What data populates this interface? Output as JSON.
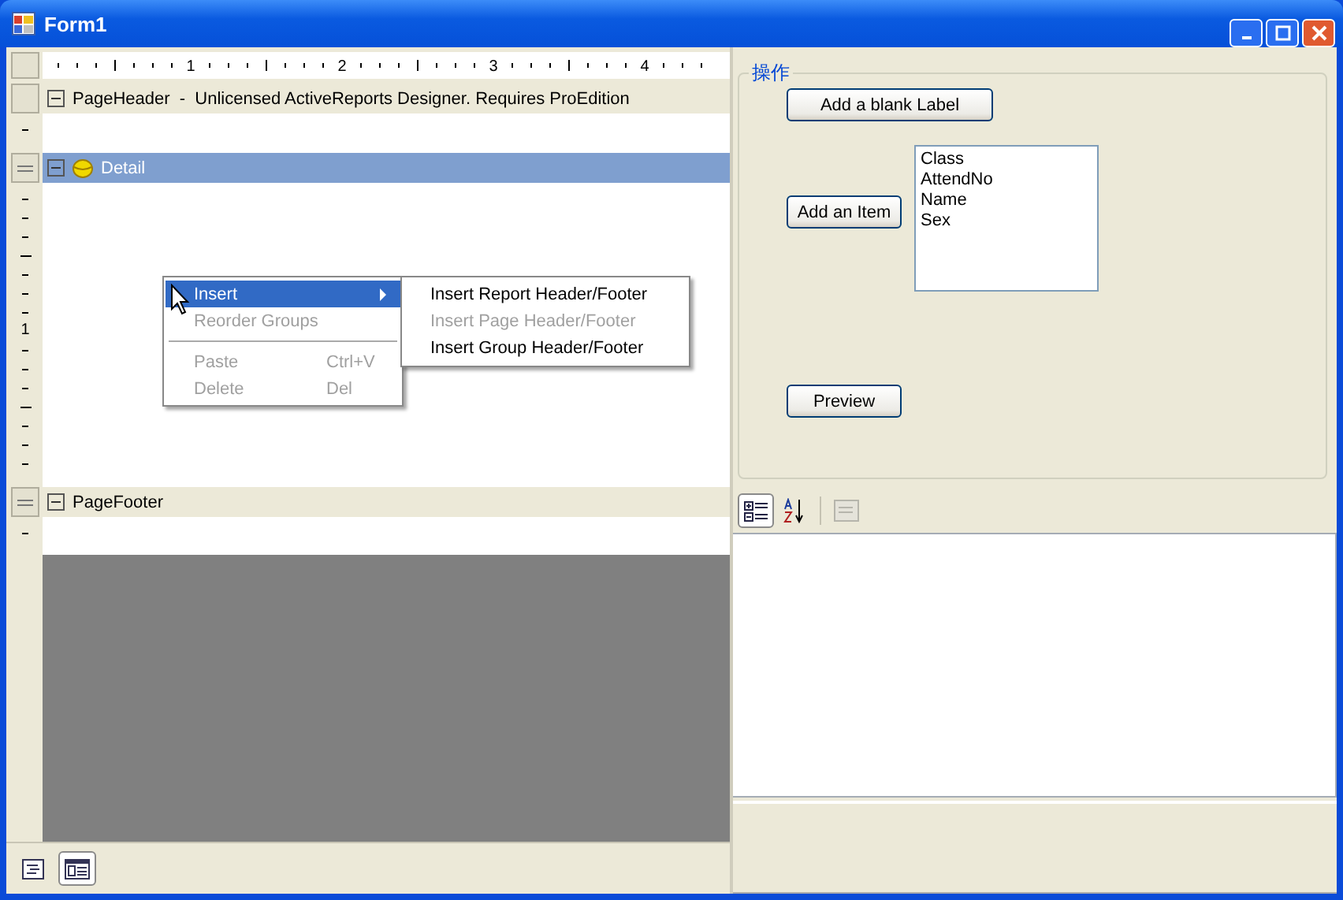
{
  "window": {
    "title": "Form1"
  },
  "designer": {
    "ruler_numbers": [
      "1",
      "2",
      "3",
      "4"
    ],
    "sections": [
      {
        "kind": "header",
        "caption": "PageHeader  -  Unlicensed ActiveReports Designer. Requires ProEdition",
        "selected": false,
        "expanded": true
      },
      {
        "kind": "detail",
        "caption": "Detail",
        "selected": true,
        "expanded": true,
        "ruler_label": "1"
      },
      {
        "kind": "footer",
        "caption": "PageFooter",
        "selected": false,
        "expanded": true
      }
    ],
    "context_menu": [
      {
        "kind": "item",
        "label": "Insert",
        "selected": true,
        "disabled": false,
        "submenu": true
      },
      {
        "kind": "item",
        "label": "Reorder Groups",
        "selected": false,
        "disabled": true
      },
      {
        "kind": "separator"
      },
      {
        "kind": "item",
        "label": "Paste",
        "shortcut": "Ctrl+V",
        "selected": false,
        "disabled": true
      },
      {
        "kind": "item",
        "label": "Delete",
        "shortcut": "Del",
        "selected": false,
        "disabled": true
      }
    ],
    "submenu": [
      {
        "label": "Insert Report Header/Footer",
        "disabled": false
      },
      {
        "label": "Insert Page Header/Footer",
        "disabled": true
      },
      {
        "label": "Insert Group Header/Footer",
        "disabled": false
      }
    ],
    "view_buttons": [
      {
        "selected": false
      },
      {
        "selected": true
      }
    ]
  },
  "group": {
    "title": "操作",
    "add_label_button": "Add a blank Label",
    "add_item_button": "Add an Item",
    "list_items": [
      "Class",
      "AttendNo",
      "Name",
      "Sex"
    ],
    "preview_button": "Preview"
  },
  "property_grid": {
    "toolbar": [
      {
        "kind": "categorized",
        "selected": true,
        "disabled": false
      },
      {
        "kind": "alphabetical",
        "selected": false,
        "disabled": false
      },
      {
        "kind": "pages",
        "selected": false,
        "disabled": true
      }
    ]
  }
}
